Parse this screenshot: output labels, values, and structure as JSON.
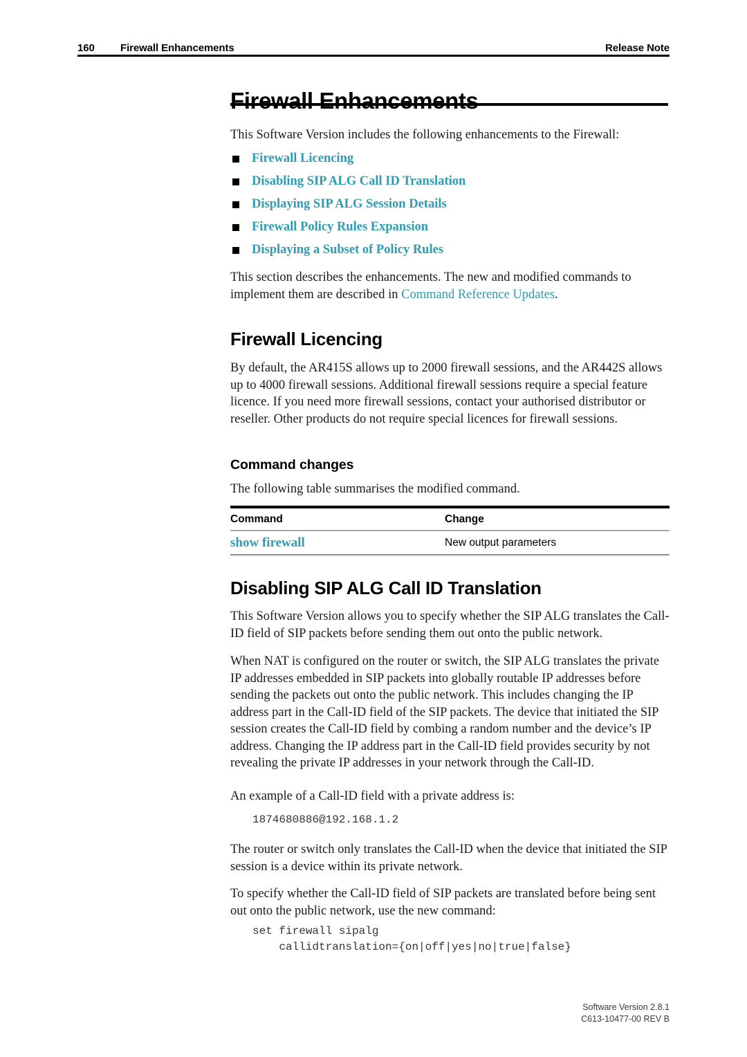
{
  "header": {
    "page_number": "160",
    "chapter": "Firewall Enhancements",
    "document_type": "Release Note"
  },
  "title": "Firewall Enhancements",
  "intro": {
    "lead": "This Software Version includes the following enhancements to the Firewall:",
    "bullets": [
      "Firewall Licencing",
      "Disabling SIP ALG Call ID Translation",
      "Displaying SIP ALG Session Details",
      "Firewall Policy Rules Expansion",
      "Displaying a Subset of Policy Rules"
    ],
    "after_list_pre": "This section describes the enhancements. The new and modified commands to implement them are described in ",
    "after_list_link": "Command Reference Updates",
    "after_list_post": "."
  },
  "licencing": {
    "heading": "Firewall Licencing",
    "paragraph": "By default, the AR415S allows up to 2000 firewall sessions, and the AR442S allows up to 4000 firewall sessions. Additional firewall sessions require a special feature licence. If you need more firewall sessions, contact your authorised distributor or reseller. Other products do not require special licences for firewall sessions.",
    "command_changes_heading": "Command changes",
    "command_changes_intro": "The following table summarises the modified command.",
    "table": {
      "columns": [
        "Command",
        "Change"
      ],
      "rows": [
        {
          "command": "show firewall",
          "change": "New output parameters"
        }
      ]
    }
  },
  "sipalg": {
    "heading": "Disabling SIP ALG Call ID Translation",
    "paragraph1": "This Software Version allows you to specify whether the SIP ALG translates the Call-ID field of SIP packets before sending them out onto the public network.",
    "paragraph2": "When NAT is configured on the router or switch, the SIP ALG translates the private IP addresses embedded in SIP packets into globally routable IP addresses before sending the packets out onto the public network. This includes changing the IP address part in the Call-ID field of the SIP packets. The device that initiated the SIP session creates the Call-ID field by combing a random number and the device’s IP address. Changing the IP address part in the Call-ID field provides security by not revealing the private IP addresses in your network through the Call-ID.",
    "example_intro": "An example of a Call-ID field with a private address is:",
    "example_code": "1874680886@192.168.1.2",
    "paragraph3": "The router or switch only translates the Call-ID when the device that initiated the SIP session is a device within its private network.",
    "paragraph4": "To specify whether the Call-ID field of SIP packets are translated before being sent out onto the public network, use the new command:",
    "command_code": "set firewall sipalg\n    callidtranslation={on|off|yes|no|true|false}"
  },
  "footer": {
    "software_version": "Software Version 2.8.1",
    "part_number": "C613-10477-00 REV B"
  },
  "colors": {
    "link": "#2e9cb3",
    "text": "#1a1a1a",
    "rule": "#000000"
  }
}
